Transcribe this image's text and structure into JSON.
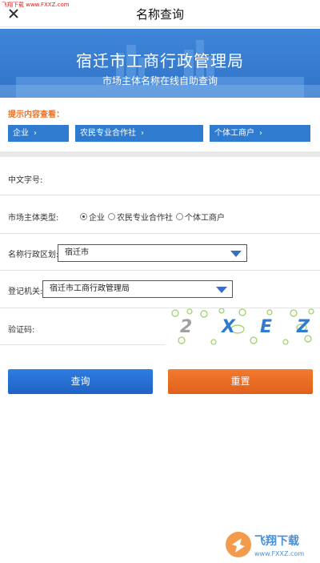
{
  "navbar": {
    "title": "名称查询",
    "watermark": "飞翔下载 www.FXXZ.com"
  },
  "banner": {
    "title": "宿迁市工商行政管理局",
    "subtitle": "市场主体名称在线自助查询"
  },
  "hint": {
    "label": "提示内容查看：",
    "tags": [
      "企业",
      "农民专业合作社",
      "个体工商户"
    ]
  },
  "form": {
    "chinese_name_label": "中文字号:",
    "entity_type_label": "市场主体类型:",
    "entity_types": [
      "企业",
      "农民专业合作社",
      "个体工商户"
    ],
    "entity_type_selected": "企业",
    "region_label": "名称行政区划:",
    "region_value": "宿迁市",
    "authority_label": "登记机关:",
    "authority_value": "宿迁市工商行政管理局",
    "captcha_label": "验证码:",
    "captcha_text": "2XEZ"
  },
  "buttons": {
    "query": "查询",
    "reset": "重置"
  },
  "logo": {
    "name": "飞翔下载",
    "url": "www.FXXZ.com"
  },
  "colors": {
    "accent_blue": "#2f7bd0",
    "accent_orange": "#e8732a"
  }
}
